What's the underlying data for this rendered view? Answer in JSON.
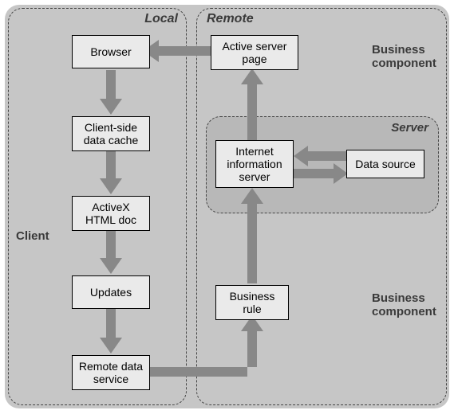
{
  "panels": {
    "local": {
      "title": "Local"
    },
    "remote": {
      "title": "Remote"
    },
    "server": {
      "title": "Server"
    }
  },
  "labels": {
    "client": "Client",
    "business_component_top": "Business\ncomponent",
    "business_component_bottom": "Business\ncomponent"
  },
  "nodes": {
    "browser": "Browser",
    "client_cache": "Client-side\ndata cache",
    "activex_doc": "ActiveX\nHTML doc",
    "updates": "Updates",
    "remote_data_service": "Remote data\nservice",
    "asp": "Active server\npage",
    "iis": "Internet\ninformation\nserver",
    "data_source": "Data source",
    "business_rule": "Business\nrule"
  }
}
